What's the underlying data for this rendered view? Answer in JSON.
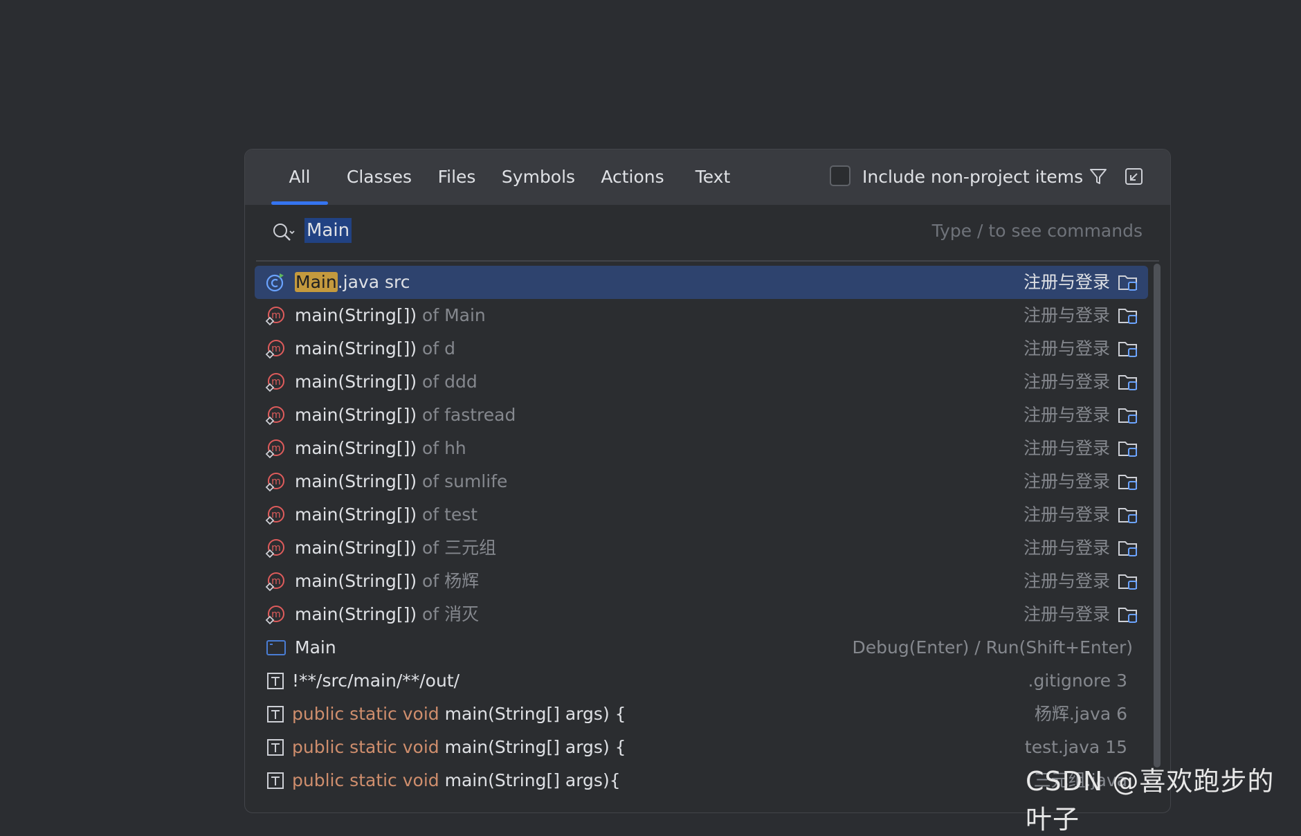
{
  "tabs": [
    {
      "label": "All",
      "active": true
    },
    {
      "label": "Classes",
      "active": false
    },
    {
      "label": "Files",
      "active": false
    },
    {
      "label": "Symbols",
      "active": false
    },
    {
      "label": "Actions",
      "active": false
    },
    {
      "label": "Text",
      "active": false
    }
  ],
  "include_non_project": {
    "label": "Include non-project items",
    "checked": false
  },
  "toolbar_icons": [
    "filter-icon",
    "collapse-icon"
  ],
  "search": {
    "value": "Main",
    "hint": "Type / to see commands"
  },
  "results": [
    {
      "type": "class",
      "selected": true,
      "highlight": "Main",
      "text": ".java src",
      "module": "注册与登录"
    },
    {
      "type": "method",
      "name": "main(String[])",
      "context": " of Main",
      "module": "注册与登录"
    },
    {
      "type": "method",
      "name": "main(String[])",
      "context": " of d",
      "module": "注册与登录"
    },
    {
      "type": "method",
      "name": "main(String[])",
      "context": " of ddd",
      "module": "注册与登录"
    },
    {
      "type": "method",
      "name": "main(String[])",
      "context": " of fastread",
      "module": "注册与登录"
    },
    {
      "type": "method",
      "name": "main(String[])",
      "context": " of hh",
      "module": "注册与登录"
    },
    {
      "type": "method",
      "name": "main(String[])",
      "context": " of sumlife",
      "module": "注册与登录"
    },
    {
      "type": "method",
      "name": "main(String[])",
      "context": " of test",
      "module": "注册与登录"
    },
    {
      "type": "method",
      "name": "main(String[])",
      "context": " of 三元组",
      "module": "注册与登录"
    },
    {
      "type": "method",
      "name": "main(String[])",
      "context": " of 杨辉",
      "module": "注册与登录"
    },
    {
      "type": "method",
      "name": "main(String[])",
      "context": " of 消灭",
      "module": "注册与登录"
    },
    {
      "type": "run-config",
      "name": "Main",
      "right": "Debug(Enter) / Run(Shift+Enter)"
    },
    {
      "type": "text",
      "name": "!**/src/main/**/out/",
      "right": ".gitignore 3"
    },
    {
      "type": "text",
      "keyword": "public static void",
      "name": " main(String[] args) {",
      "right": "杨辉.java 6"
    },
    {
      "type": "text",
      "keyword": "public static void",
      "name": " main(String[] args) {",
      "right": "test.java 15"
    },
    {
      "type": "text",
      "keyword": "public static void",
      "name": " main(String[] args){",
      "right": "三元组.java"
    }
  ],
  "watermark": "CSDN @喜欢跑步的叶子",
  "colors": {
    "accent": "#3574f0",
    "selection": "#2e436e",
    "match_highlight": "#c49a3e",
    "keyword": "#cf8e6d",
    "method_icon": "#e05c5c"
  }
}
